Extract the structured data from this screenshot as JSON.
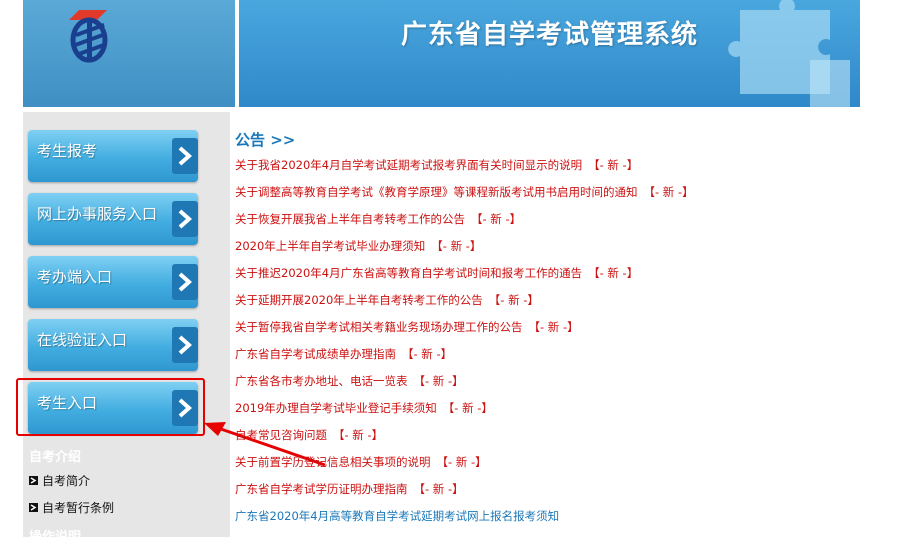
{
  "header": {
    "title": "广东省自学考试管理系统"
  },
  "sidebar": {
    "buttons": [
      {
        "label": "考生报考"
      },
      {
        "label": "网上办事服务入口"
      },
      {
        "label": "考办端入口"
      },
      {
        "label": "在线验证入口"
      },
      {
        "label": "考生入口"
      }
    ],
    "section1": {
      "title": "自考介绍",
      "links": [
        "自考简介",
        "自考暂行条例"
      ]
    },
    "section2": {
      "title": "操作说明"
    }
  },
  "main": {
    "title": "公告 >>",
    "new_tag": "【- 新 -】",
    "announcements": [
      "关于我省2020年4月自学考试延期考试报考界面有关时间显示的说明",
      "关于调整高等教育自学考试《教育学原理》等课程新版考试用书启用时间的通知",
      "关于恢复开展我省上半年自考转考工作的公告",
      "2020年上半年自学考试毕业办理须知",
      "关于推迟2020年4月广东省高等教育自学考试时间和报考工作的通告",
      "关于延期开展2020年上半年自考转考工作的公告",
      "关于暂停我省自学考试相关考籍业务现场办理工作的公告",
      "广东省自学考试成绩单办理指南",
      "广东省各市考办地址、电话一览表",
      "2019年办理自学考试毕业登记手续须知",
      "自考常见咨询问题",
      "关于前置学历登记信息相关事项的说明",
      "广东省自学考试学历证明办理指南"
    ],
    "last_announcement": "广东省2020年4月高等教育自学考试延期考试网上报名报考须知"
  },
  "colors": {
    "accent": "#1b78b8",
    "link_red": "#cc1111",
    "highlight": "#e60000"
  }
}
